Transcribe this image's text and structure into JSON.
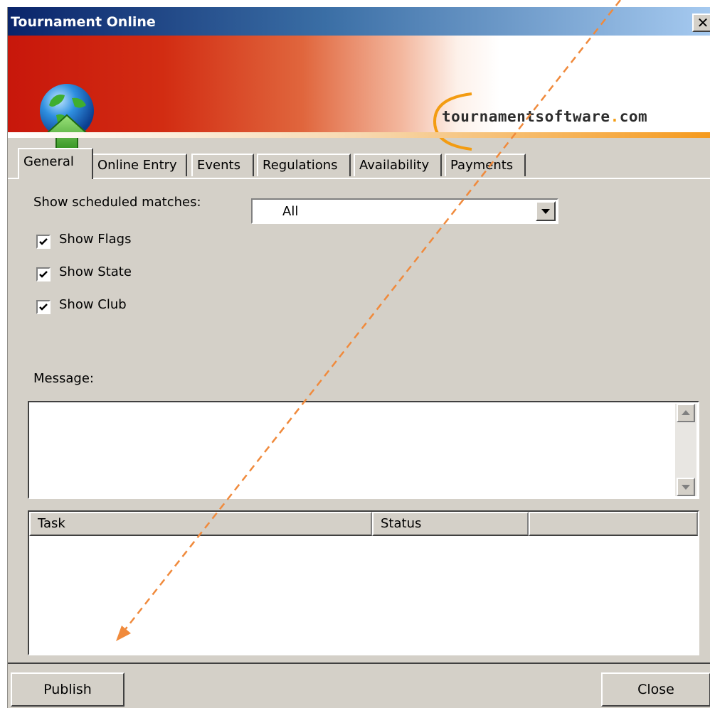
{
  "window": {
    "title": "Tournament Online",
    "close_glyph": "✕"
  },
  "banner": {
    "logo_prefix": "tournamentsoftware",
    "logo_dot": ".",
    "logo_suffix": "com",
    "icon": "globe-upload-icon"
  },
  "tabs": [
    {
      "label": "General",
      "active": true
    },
    {
      "label": "Online Entry",
      "active": false
    },
    {
      "label": "Events",
      "active": false
    },
    {
      "label": "Regulations",
      "active": false
    },
    {
      "label": "Availability",
      "active": false
    },
    {
      "label": "Payments",
      "active": false
    }
  ],
  "general": {
    "scheduled_label": "Show scheduled matches:",
    "scheduled_value": "All",
    "checkboxes": [
      {
        "label": "Show Flags",
        "checked": true
      },
      {
        "label": "Show State",
        "checked": true
      },
      {
        "label": "Show Club",
        "checked": true
      }
    ],
    "message_label": "Message:",
    "message_value": ""
  },
  "task_list": {
    "columns": [
      "Task",
      "Status",
      ""
    ],
    "rows": []
  },
  "buttons": {
    "publish": "Publish",
    "close": "Close"
  },
  "colors": {
    "title_bar": "#0a246a",
    "banner_red": "#c8170b",
    "accent_orange": "#f39c12",
    "dialog_face": "#d4d0c8",
    "annotation_arrow": "#f08a3c"
  }
}
